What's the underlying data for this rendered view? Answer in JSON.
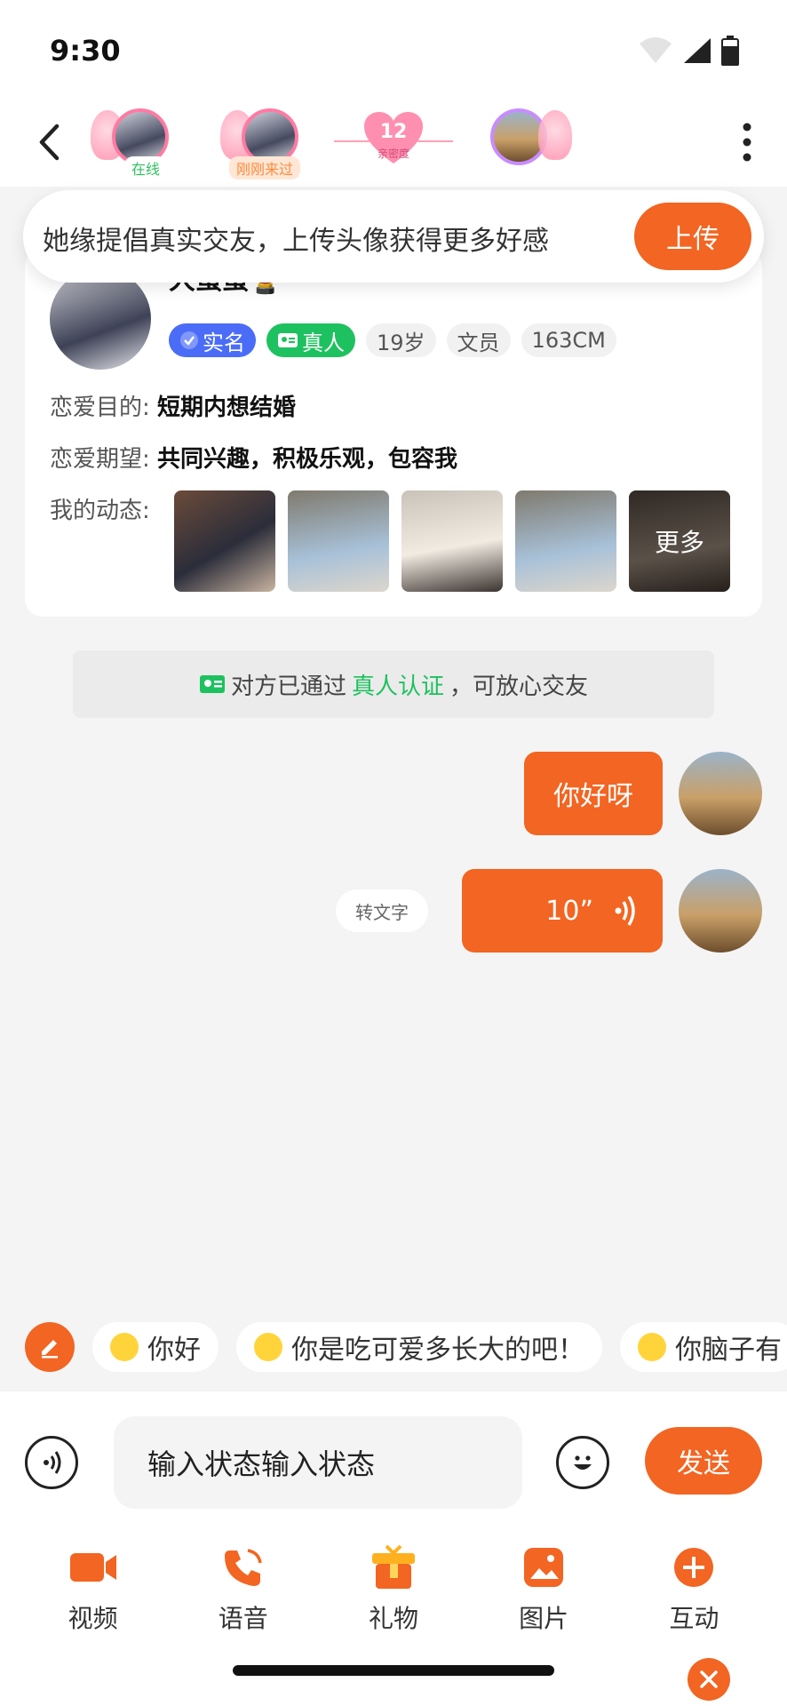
{
  "status_bar": {
    "time": "9:30"
  },
  "header": {
    "avatars": [
      {
        "label": "在线",
        "label_color": "#2ec05f"
      },
      {
        "label": "刚刚来过",
        "label_color": "#ff8a3c"
      }
    ],
    "intimacy": {
      "value": "12",
      "label": "亲密度"
    }
  },
  "banner": {
    "text": "她缘提倡真实交友，上传头像获得更多好感",
    "button": "上传"
  },
  "profile": {
    "name": "大蛋蛋💄",
    "tags": {
      "realname": "实名",
      "realperson": "真人",
      "age": "19岁",
      "job": "文员",
      "height": "163CM"
    },
    "purpose_label": "恋爱目的:",
    "purpose_value": "短期内想结婚",
    "expect_label": "恋爱期望:",
    "expect_value": "共同兴趣，积极乐观，包容我",
    "moments_label": "我的动态:",
    "moments_more": "更多"
  },
  "verify": {
    "prefix": "对方已通过",
    "highlight": "真人认证",
    "suffix": "，可放心交友"
  },
  "messages": [
    {
      "type": "text",
      "text": "你好呀"
    },
    {
      "type": "voice",
      "duration": "10”",
      "to_text": "转文字"
    }
  ],
  "quick_replies": [
    "你好",
    "你是吃可爱多长大的吧！",
    "你脑子有"
  ],
  "input": {
    "value": "输入状态输入状态",
    "send": "发送"
  },
  "toolbar": [
    {
      "label": "视频",
      "icon": "video-icon"
    },
    {
      "label": "语音",
      "icon": "phone-icon"
    },
    {
      "label": "礼物",
      "icon": "gift-icon"
    },
    {
      "label": "图片",
      "icon": "image-icon"
    },
    {
      "label": "互动",
      "icon": "plus-icon"
    }
  ],
  "colors": {
    "accent": "#f26522",
    "green": "#1ec15f",
    "blue": "#4a6cf7"
  }
}
